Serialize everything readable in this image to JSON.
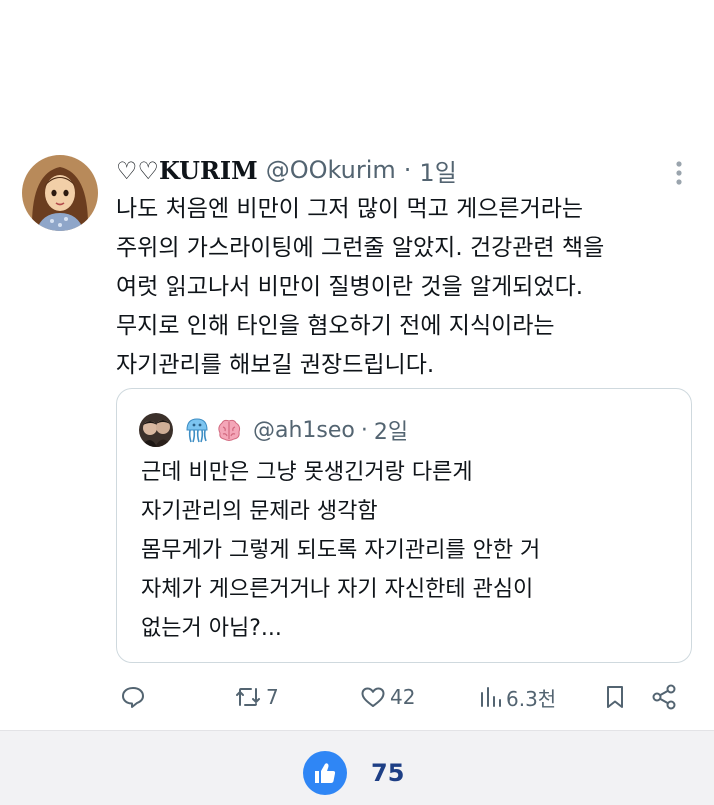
{
  "tweet": {
    "display_name": "♡♡KURIM",
    "handle": "@OOkurim",
    "separator": "·",
    "time": "1일",
    "body_lines": [
      "나도 처음엔 비만이 그저 많이 먹고 게으른거라는",
      "주위의 가스라이팅에 그런줄 알았지. 건강관련 책을",
      "여럿 읽고나서 비만이 질병이란 것을 알게되었다.",
      "무지로 인해 타인을 혐오하기 전에 지식이라는",
      "자기관리를 해보길 권장드립니다."
    ],
    "more_icon": "more-dots-icon"
  },
  "quote": {
    "name_emojis": [
      "jellyfish-emoji",
      "brain-emoji"
    ],
    "handle": "@ah1seo",
    "separator": "·",
    "time": "2일",
    "body_lines": [
      "근데 비만은 그냥 못생긴거랑 다른게",
      "자기관리의 문제라 생각함",
      "몸무게가 그렇게 되도록 자기관리를 안한 거",
      "자체가 게으른거거나 자기 자신한테 관심이",
      "없는거 아님?..."
    ]
  },
  "actions": {
    "reply": {
      "icon": "reply-icon"
    },
    "retweet": {
      "icon": "retweet-icon",
      "count": "7"
    },
    "like": {
      "icon": "heart-icon",
      "count": "42"
    },
    "views": {
      "icon": "views-icon",
      "count": "6.3천"
    },
    "bookmark": {
      "icon": "bookmark-icon"
    },
    "share": {
      "icon": "share-icon"
    }
  },
  "bottom_bar": {
    "like_icon": "thumbs-up-icon",
    "like_count": "75"
  },
  "colors": {
    "text": "#0f1419",
    "secondary": "#536471",
    "border": "#cfd9de",
    "like_blue": "#2f86f5",
    "like_count": "#1e3f85",
    "bar_bg": "#f2f2f4"
  }
}
